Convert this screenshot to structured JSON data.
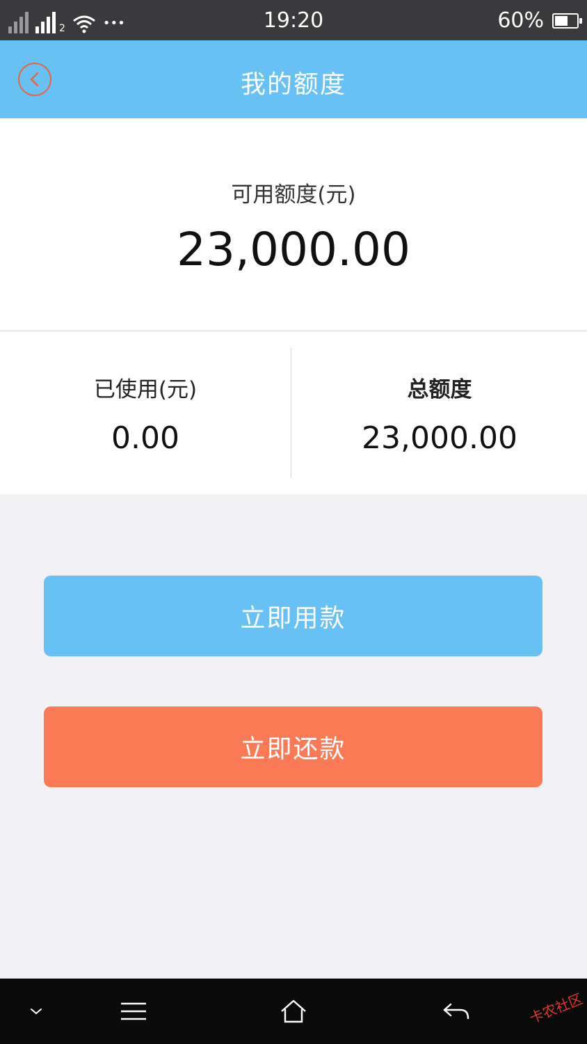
{
  "status_bar": {
    "time": "19:20",
    "battery_percent": "60%",
    "battery_level": 0.6,
    "sim2_label": "2",
    "more_indicator": "•••"
  },
  "header": {
    "title": "我的额度",
    "back_icon": "back-chevron-circle-icon"
  },
  "credit": {
    "available_label": "可用额度(元)",
    "available_value": "23,000.00",
    "used_label": "已使用(元)",
    "used_value": "0.00",
    "total_label": "总额度",
    "total_value": "23,000.00"
  },
  "actions": {
    "use_label": "立即用款",
    "repay_label": "立即还款"
  },
  "nav_bar": {
    "icons": [
      "chevron-down-icon",
      "menu-icon",
      "home-icon",
      "back-arrow-icon"
    ]
  },
  "watermark": {
    "text": "卡农社区"
  },
  "colors": {
    "header": "#67c1f5",
    "use_button": "#67c1f5",
    "repay_button": "#fa7a55",
    "back_accent": "#e8653f",
    "watermark": "#e2352d"
  }
}
